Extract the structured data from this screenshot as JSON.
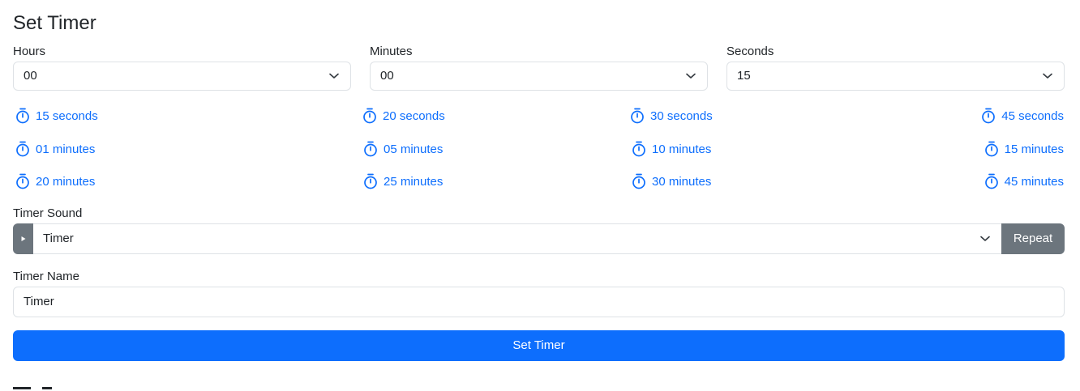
{
  "form": {
    "title": "Set Timer",
    "hours": {
      "label": "Hours",
      "value": "00"
    },
    "minutes": {
      "label": "Minutes",
      "value": "00"
    },
    "seconds": {
      "label": "Seconds",
      "value": "15"
    },
    "presets": [
      "15 seconds",
      "20 seconds",
      "30 seconds",
      "45 seconds",
      "01 minutes",
      "05 minutes",
      "10 minutes",
      "15 minutes",
      "20 minutes",
      "25 minutes",
      "30 minutes",
      "45 minutes"
    ],
    "sound": {
      "label": "Timer Sound",
      "value": "Timer",
      "repeat_label": "Repeat"
    },
    "name": {
      "label": "Timer Name",
      "value": "Timer"
    },
    "submit_label": "Set Timer"
  },
  "colors": {
    "primary": "#0d6efd",
    "secondary": "#6c757d",
    "border": "#dee2e6",
    "text": "#212529"
  },
  "icons": {
    "preset": "stopwatch-icon",
    "dropdown": "chevron-down-icon",
    "play": "play-icon"
  }
}
